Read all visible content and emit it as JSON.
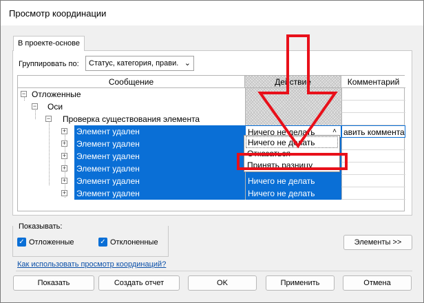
{
  "window": {
    "title": "Просмотр координации"
  },
  "tab": {
    "label": "В проекте-основе"
  },
  "group_by": {
    "label": "Группировать по:",
    "value": "Статус, категория, прави."
  },
  "grid": {
    "headers": {
      "message": "Сообщение",
      "action": "Действие",
      "comment": "Комментарий"
    },
    "tree": {
      "level1": "Отложенные",
      "level2": "Оси",
      "level3": "Проверка существования элемента"
    },
    "rows": [
      {
        "message": "Элемент удален",
        "action": "Ничего не делать",
        "comment": "авить коммента"
      },
      {
        "message": "Элемент удален",
        "action": "",
        "comment": ""
      },
      {
        "message": "Элемент удален",
        "action": "",
        "comment": ""
      },
      {
        "message": "Элемент удален",
        "action": "",
        "comment": ""
      },
      {
        "message": "Элемент удален",
        "action": "Ничего не делать",
        "comment": ""
      },
      {
        "message": "Элемент удален",
        "action": "Ничего не делать",
        "comment": ""
      }
    ],
    "dropdown_options": [
      "Ничего не делать",
      "Отказаться",
      "Принять разницу"
    ]
  },
  "show": {
    "label": "Показывать:",
    "postponed": "Отложенные",
    "rejected": "Отклоненные"
  },
  "buttons": {
    "elements": "Элементы >>",
    "show": "Показать",
    "create_report": "Создать отчет",
    "ok": "OK",
    "apply": "Применить",
    "cancel": "Отмена"
  },
  "help_link": "Как использовать просмотр координаций?",
  "colors": {
    "selection": "#0a6fd6",
    "annotation": "#e8101a"
  }
}
